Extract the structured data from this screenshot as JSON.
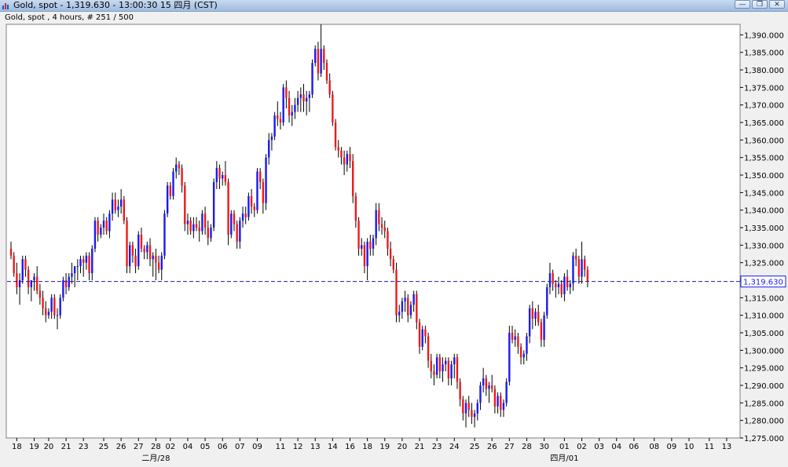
{
  "window": {
    "title": "Gold, spot - 1,319.630 - 13:00:30  15 四月 (CST)",
    "minimize_label": "—",
    "restore_label": "❐",
    "close_label": "✕"
  },
  "chart_caption": "Gold, spot , 4 hours, # 251 / 500",
  "colors": {
    "up": "#1a1aee",
    "down": "#ee1a1a",
    "wick": "#000000",
    "reference_line": "#1a1aaa",
    "price_tag_border": "#1a1aee"
  },
  "chart_data": {
    "type": "candlestick",
    "title": "Gold, spot , 4 hours, # 251 / 500",
    "ylim": [
      1275,
      1393
    ],
    "y_ticks": [
      1275,
      1280,
      1285,
      1290,
      1295,
      1300,
      1305,
      1310,
      1315,
      1320,
      1325,
      1330,
      1335,
      1340,
      1345,
      1350,
      1355,
      1360,
      1365,
      1370,
      1375,
      1380,
      1385,
      1390
    ],
    "y_tick_labels": [
      "1,275.000",
      "1,280.000",
      "1,285.000",
      "1,290.000",
      "1,295.000",
      "1,300.000",
      "1,305.000",
      "1,310.000",
      "1,315.000",
      "1,320.000",
      "1,325.000",
      "1,330.000",
      "1,335.000",
      "1,340.000",
      "1,345.000",
      "1,350.000",
      "1,355.000",
      "1,360.000",
      "1,365.000",
      "1,370.000",
      "1,375.000",
      "1,380.000",
      "1,385.000",
      "1,390.000"
    ],
    "x_ticks": [
      {
        "label": "18",
        "index": 2
      },
      {
        "label": "19",
        "index": 8
      },
      {
        "label": "20",
        "index": 13
      },
      {
        "label": "21",
        "index": 19
      },
      {
        "label": "23",
        "index": 25
      },
      {
        "label": "25",
        "index": 32
      },
      {
        "label": "26",
        "index": 38
      },
      {
        "label": "27",
        "index": 44
      },
      {
        "label": "28",
        "index": 50
      },
      {
        "label": "02",
        "index": 55
      },
      {
        "label": "04",
        "index": 61
      },
      {
        "label": "05",
        "index": 67
      },
      {
        "label": "06",
        "index": 73
      },
      {
        "label": "07",
        "index": 79
      },
      {
        "label": "09",
        "index": 85
      },
      {
        "label": "11",
        "index": 93
      },
      {
        "label": "12",
        "index": 99
      },
      {
        "label": "13",
        "index": 105
      },
      {
        "label": "14",
        "index": 111
      },
      {
        "label": "16",
        "index": 117
      },
      {
        "label": "18",
        "index": 123
      },
      {
        "label": "19",
        "index": 129
      },
      {
        "label": "20",
        "index": 135
      },
      {
        "label": "21",
        "index": 141
      },
      {
        "label": "23",
        "index": 147
      },
      {
        "label": "24",
        "index": 153
      },
      {
        "label": "25",
        "index": 160
      },
      {
        "label": "26",
        "index": 166
      },
      {
        "label": "27",
        "index": 172
      },
      {
        "label": "28",
        "index": 178
      },
      {
        "label": "30",
        "index": 184
      },
      {
        "label": "01",
        "index": 191
      },
      {
        "label": "02",
        "index": 197
      },
      {
        "label": "03",
        "index": 203
      },
      {
        "label": "04",
        "index": 209
      },
      {
        "label": "06",
        "index": 215
      },
      {
        "label": "08",
        "index": 222
      },
      {
        "label": "09",
        "index": 228
      },
      {
        "label": "10",
        "index": 234
      },
      {
        "label": "11",
        "index": 241
      },
      {
        "label": "13",
        "index": 247
      }
    ],
    "x_major_labels": [
      {
        "label": "二月/28",
        "index": 50
      },
      {
        "label": "四月/01",
        "index": 191
      }
    ],
    "reference_line": {
      "value": 1319.63,
      "label": "1,319.630"
    },
    "candles": [
      [
        1329,
        1331,
        1326,
        1327
      ],
      [
        1327,
        1328,
        1321,
        1322
      ],
      [
        1322,
        1325,
        1316,
        1318
      ],
      [
        1318,
        1322,
        1313,
        1320
      ],
      [
        1320,
        1327,
        1319,
        1326
      ],
      [
        1326,
        1327,
        1321,
        1323
      ],
      [
        1323,
        1324,
        1316,
        1318
      ],
      [
        1318,
        1320,
        1314,
        1320
      ],
      [
        1320,
        1322,
        1317,
        1321
      ],
      [
        1321,
        1324,
        1316,
        1317
      ],
      [
        1317,
        1319,
        1313,
        1315
      ],
      [
        1315,
        1317,
        1310,
        1312
      ],
      [
        1312,
        1314,
        1308,
        1310
      ],
      [
        1310,
        1312,
        1309,
        1311
      ],
      [
        1311,
        1316,
        1309,
        1315
      ],
      [
        1315,
        1316,
        1309,
        1310
      ],
      [
        1310,
        1312,
        1306,
        1310
      ],
      [
        1310,
        1316,
        1309,
        1315
      ],
      [
        1315,
        1321,
        1314,
        1320
      ],
      [
        1320,
        1322,
        1316,
        1318
      ],
      [
        1318,
        1322,
        1317,
        1321
      ],
      [
        1321,
        1325,
        1319,
        1322
      ],
      [
        1322,
        1324,
        1318,
        1324
      ],
      [
        1324,
        1326,
        1320,
        1324
      ],
      [
        1324,
        1327,
        1322,
        1326
      ],
      [
        1326,
        1327,
        1321,
        1325
      ],
      [
        1325,
        1328,
        1323,
        1327
      ],
      [
        1327,
        1328,
        1320,
        1322
      ],
      [
        1322,
        1330,
        1320,
        1329
      ],
      [
        1329,
        1338,
        1328,
        1337
      ],
      [
        1337,
        1338,
        1331,
        1333
      ],
      [
        1333,
        1336,
        1332,
        1335
      ],
      [
        1335,
        1339,
        1333,
        1337
      ],
      [
        1337,
        1338,
        1333,
        1334
      ],
      [
        1334,
        1340,
        1332,
        1339
      ],
      [
        1339,
        1345,
        1337,
        1343
      ],
      [
        1343,
        1345,
        1339,
        1340
      ],
      [
        1340,
        1343,
        1338,
        1341
      ],
      [
        1341,
        1346,
        1339,
        1343
      ],
      [
        1343,
        1344,
        1336,
        1337
      ],
      [
        1337,
        1338,
        1322,
        1324
      ],
      [
        1324,
        1331,
        1322,
        1330
      ],
      [
        1330,
        1331,
        1325,
        1327
      ],
      [
        1327,
        1329,
        1322,
        1324
      ],
      [
        1324,
        1334,
        1323,
        1333
      ],
      [
        1333,
        1335,
        1328,
        1329
      ],
      [
        1329,
        1330,
        1326,
        1328
      ],
      [
        1328,
        1331,
        1326,
        1330
      ],
      [
        1330,
        1332,
        1324,
        1326
      ],
      [
        1326,
        1328,
        1321,
        1327
      ],
      [
        1327,
        1329,
        1320,
        1325
      ],
      [
        1325,
        1327,
        1322,
        1323
      ],
      [
        1323,
        1328,
        1320,
        1327
      ],
      [
        1327,
        1340,
        1326,
        1339
      ],
      [
        1339,
        1348,
        1338,
        1347
      ],
      [
        1347,
        1348,
        1343,
        1344
      ],
      [
        1344,
        1352,
        1343,
        1351
      ],
      [
        1351,
        1355,
        1349,
        1353
      ],
      [
        1353,
        1354,
        1350,
        1352
      ],
      [
        1352,
        1353,
        1345,
        1347
      ],
      [
        1347,
        1348,
        1334,
        1336
      ],
      [
        1336,
        1339,
        1333,
        1337
      ],
      [
        1337,
        1338,
        1333,
        1334
      ],
      [
        1334,
        1338,
        1332,
        1336
      ],
      [
        1336,
        1338,
        1334,
        1335
      ],
      [
        1335,
        1337,
        1331,
        1334
      ],
      [
        1334,
        1340,
        1333,
        1339
      ],
      [
        1339,
        1341,
        1333,
        1335
      ],
      [
        1335,
        1337,
        1330,
        1332
      ],
      [
        1332,
        1336,
        1331,
        1335
      ],
      [
        1335,
        1349,
        1334,
        1348
      ],
      [
        1348,
        1354,
        1346,
        1352
      ],
      [
        1352,
        1353,
        1346,
        1349
      ],
      [
        1349,
        1351,
        1347,
        1350
      ],
      [
        1350,
        1354,
        1347,
        1348
      ],
      [
        1348,
        1349,
        1330,
        1333
      ],
      [
        1333,
        1340,
        1332,
        1339
      ],
      [
        1339,
        1340,
        1334,
        1336
      ],
      [
        1336,
        1337,
        1329,
        1331
      ],
      [
        1331,
        1338,
        1329,
        1337
      ],
      [
        1337,
        1341,
        1335,
        1339
      ],
      [
        1339,
        1341,
        1336,
        1338
      ],
      [
        1338,
        1345,
        1337,
        1344
      ],
      [
        1344,
        1346,
        1339,
        1341
      ],
      [
        1341,
        1342,
        1338,
        1340
      ],
      [
        1340,
        1352,
        1339,
        1351
      ],
      [
        1351,
        1352,
        1346,
        1348
      ],
      [
        1348,
        1349,
        1339,
        1342
      ],
      [
        1342,
        1356,
        1340,
        1355
      ],
      [
        1355,
        1362,
        1353,
        1360
      ],
      [
        1360,
        1362,
        1357,
        1361
      ],
      [
        1361,
        1368,
        1360,
        1367
      ],
      [
        1367,
        1371,
        1364,
        1366
      ],
      [
        1366,
        1368,
        1363,
        1365
      ],
      [
        1365,
        1376,
        1364,
        1375
      ],
      [
        1375,
        1377,
        1369,
        1372
      ],
      [
        1372,
        1374,
        1365,
        1367
      ],
      [
        1367,
        1370,
        1364,
        1368
      ],
      [
        1368,
        1372,
        1366,
        1370
      ],
      [
        1370,
        1374,
        1368,
        1372
      ],
      [
        1372,
        1375,
        1368,
        1373
      ],
      [
        1373,
        1376,
        1368,
        1371
      ],
      [
        1371,
        1374,
        1367,
        1372
      ],
      [
        1372,
        1374,
        1368,
        1373
      ],
      [
        1373,
        1383,
        1372,
        1382
      ],
      [
        1382,
        1387,
        1381,
        1386
      ],
      [
        1386,
        1388,
        1377,
        1379
      ],
      [
        1379,
        1393,
        1378,
        1386
      ],
      [
        1386,
        1387,
        1380,
        1382
      ],
      [
        1382,
        1383,
        1376,
        1377
      ],
      [
        1377,
        1379,
        1372,
        1373
      ],
      [
        1373,
        1374,
        1364,
        1365
      ],
      [
        1365,
        1366,
        1357,
        1358
      ],
      [
        1358,
        1360,
        1355,
        1357
      ],
      [
        1357,
        1358,
        1353,
        1355
      ],
      [
        1355,
        1357,
        1350,
        1353
      ],
      [
        1353,
        1357,
        1351,
        1356
      ],
      [
        1356,
        1358,
        1352,
        1354
      ],
      [
        1354,
        1356,
        1342,
        1344
      ],
      [
        1344,
        1345,
        1335,
        1337
      ],
      [
        1337,
        1338,
        1327,
        1329
      ],
      [
        1329,
        1332,
        1327,
        1330
      ],
      [
        1330,
        1331,
        1322,
        1324
      ],
      [
        1324,
        1332,
        1320,
        1331
      ],
      [
        1331,
        1333,
        1327,
        1329
      ],
      [
        1329,
        1333,
        1327,
        1332
      ],
      [
        1332,
        1342,
        1330,
        1340
      ],
      [
        1340,
        1342,
        1334,
        1336
      ],
      [
        1336,
        1338,
        1333,
        1335
      ],
      [
        1335,
        1337,
        1332,
        1334
      ],
      [
        1334,
        1335,
        1327,
        1329
      ],
      [
        1329,
        1331,
        1324,
        1326
      ],
      [
        1326,
        1327,
        1322,
        1323
      ],
      [
        1323,
        1325,
        1308,
        1310
      ],
      [
        1310,
        1313,
        1308,
        1311
      ],
      [
        1311,
        1315,
        1309,
        1314
      ],
      [
        1314,
        1317,
        1311,
        1315
      ],
      [
        1315,
        1316,
        1308,
        1310
      ],
      [
        1310,
        1314,
        1309,
        1313
      ],
      [
        1313,
        1317,
        1311,
        1316
      ],
      [
        1316,
        1317,
        1306,
        1308
      ],
      [
        1308,
        1309,
        1299,
        1301
      ],
      [
        1301,
        1307,
        1300,
        1306
      ],
      [
        1306,
        1307,
        1302,
        1304
      ],
      [
        1304,
        1305,
        1295,
        1297
      ],
      [
        1297,
        1299,
        1292,
        1294
      ],
      [
        1294,
        1296,
        1290,
        1293
      ],
      [
        1293,
        1299,
        1292,
        1298
      ],
      [
        1298,
        1299,
        1292,
        1294
      ],
      [
        1294,
        1298,
        1291,
        1296
      ],
      [
        1296,
        1298,
        1294,
        1297
      ],
      [
        1297,
        1298,
        1290,
        1292
      ],
      [
        1292,
        1297,
        1290,
        1296
      ],
      [
        1296,
        1299,
        1292,
        1298
      ],
      [
        1298,
        1299,
        1289,
        1291
      ],
      [
        1291,
        1292,
        1284,
        1286
      ],
      [
        1286,
        1287,
        1280,
        1282
      ],
      [
        1282,
        1286,
        1278,
        1285
      ],
      [
        1285,
        1287,
        1281,
        1283
      ],
      [
        1283,
        1285,
        1279,
        1281
      ],
      [
        1281,
        1283,
        1278,
        1282
      ],
      [
        1282,
        1286,
        1280,
        1285
      ],
      [
        1285,
        1291,
        1283,
        1290
      ],
      [
        1290,
        1295,
        1288,
        1292
      ],
      [
        1292,
        1293,
        1287,
        1289
      ],
      [
        1289,
        1291,
        1285,
        1290
      ],
      [
        1290,
        1293,
        1288,
        1289
      ],
      [
        1289,
        1290,
        1282,
        1284
      ],
      [
        1284,
        1288,
        1282,
        1287
      ],
      [
        1287,
        1288,
        1281,
        1283
      ],
      [
        1283,
        1286,
        1281,
        1285
      ],
      [
        1285,
        1292,
        1284,
        1291
      ],
      [
        1291,
        1307,
        1290,
        1305
      ],
      [
        1305,
        1307,
        1302,
        1303
      ],
      [
        1303,
        1306,
        1301,
        1304
      ],
      [
        1304,
        1305,
        1299,
        1301
      ],
      [
        1301,
        1302,
        1296,
        1298
      ],
      [
        1298,
        1300,
        1296,
        1299
      ],
      [
        1299,
        1305,
        1297,
        1304
      ],
      [
        1304,
        1313,
        1302,
        1312
      ],
      [
        1312,
        1314,
        1306,
        1309
      ],
      [
        1309,
        1312,
        1307,
        1311
      ],
      [
        1311,
        1313,
        1307,
        1308
      ],
      [
        1308,
        1309,
        1301,
        1303
      ],
      [
        1303,
        1311,
        1301,
        1310
      ],
      [
        1310,
        1319,
        1309,
        1318
      ],
      [
        1318,
        1325,
        1316,
        1322
      ],
      [
        1322,
        1323,
        1317,
        1319
      ],
      [
        1319,
        1320,
        1315,
        1318
      ],
      [
        1318,
        1321,
        1316,
        1319
      ],
      [
        1319,
        1320,
        1315,
        1316
      ],
      [
        1316,
        1322,
        1314,
        1321
      ],
      [
        1321,
        1323,
        1317,
        1318
      ],
      [
        1318,
        1320,
        1316,
        1319
      ],
      [
        1319,
        1328,
        1317,
        1327
      ],
      [
        1327,
        1329,
        1324,
        1326
      ],
      [
        1326,
        1327,
        1319,
        1321
      ],
      [
        1321,
        1331,
        1319,
        1326
      ],
      [
        1326,
        1327,
        1321,
        1323
      ],
      [
        1323,
        1324,
        1318,
        1319.6
      ]
    ]
  }
}
